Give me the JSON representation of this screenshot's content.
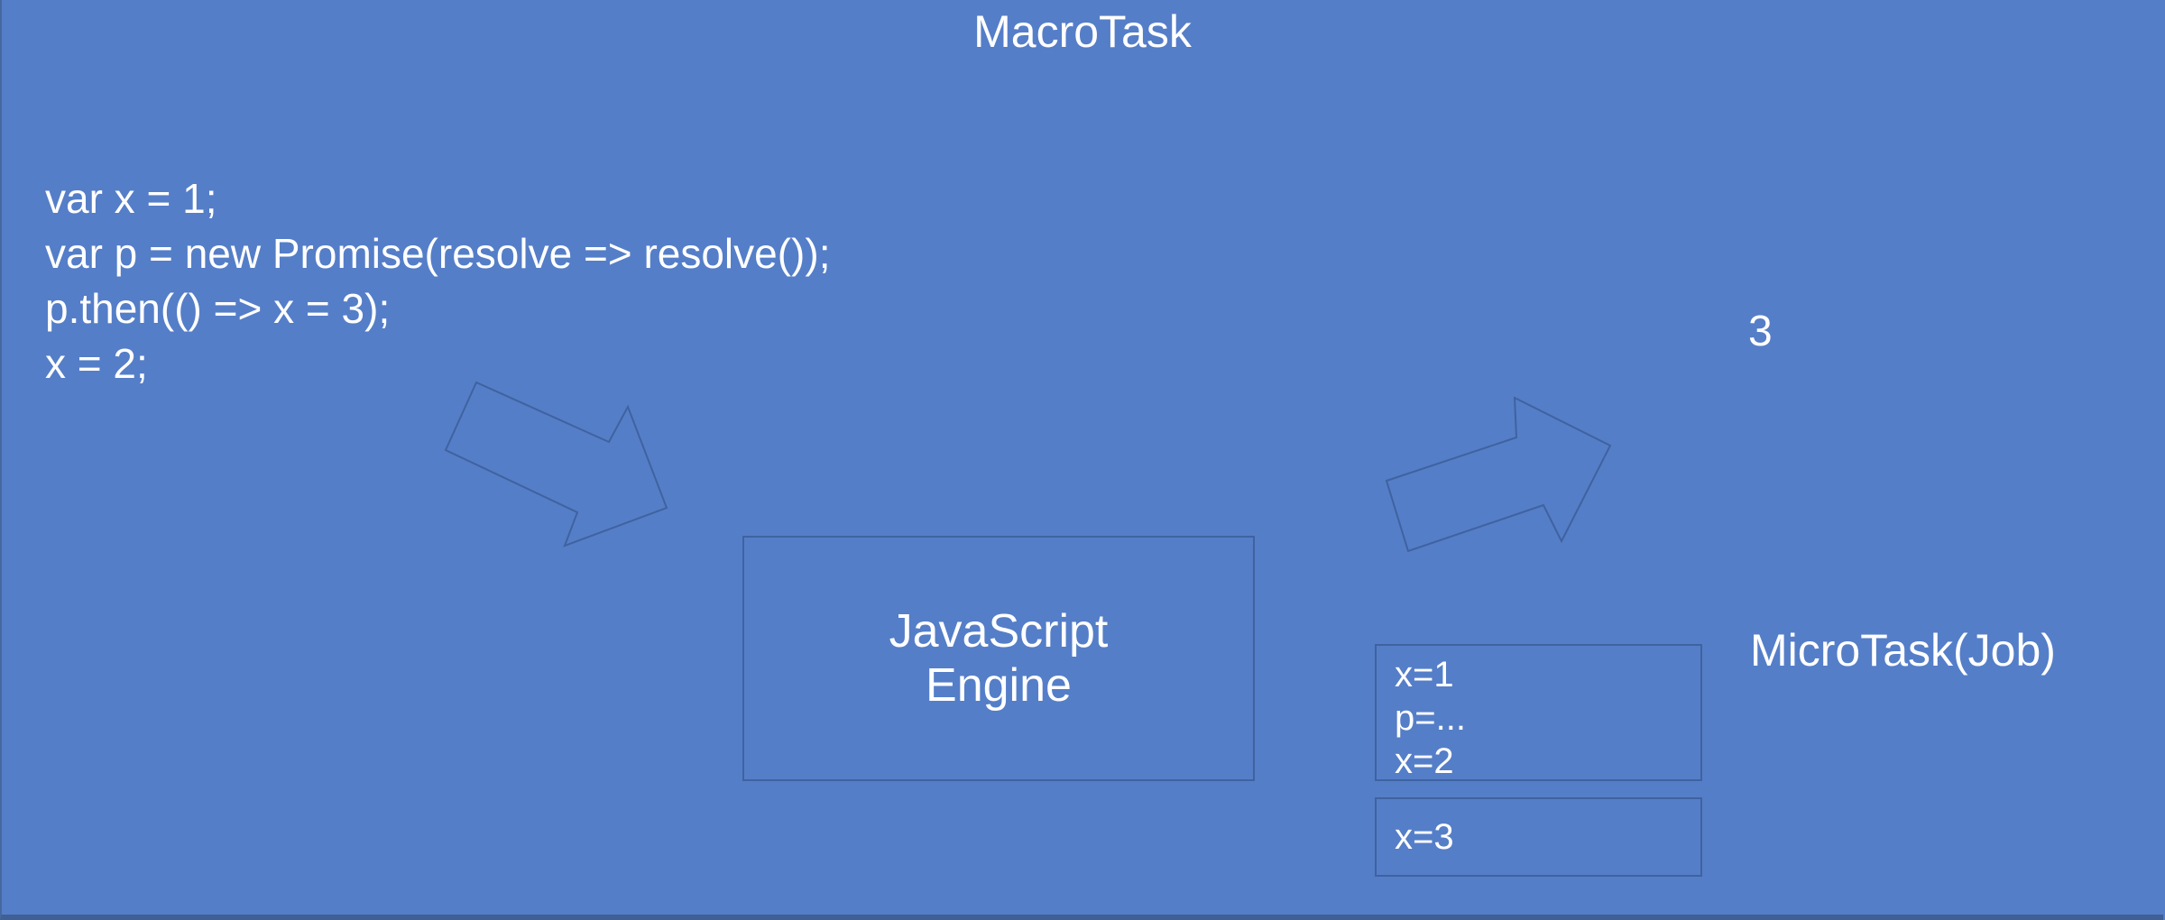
{
  "title": "MacroTask",
  "code_lines": [
    "var x = 1;",
    "var p = new Promise(resolve => resolve());",
    "p.then(() => x = 3);",
    "x = 2;"
  ],
  "engine": {
    "line1": "JavaScript",
    "line2": "Engine"
  },
  "result": "3",
  "microtask_label": "MicroTask(Job)",
  "queue_box_1": [
    "x=1",
    "p=...",
    "x=2"
  ],
  "queue_box_2": [
    "x=3"
  ],
  "colors": {
    "background": "#557ec8",
    "border": "#3e63a0",
    "text": "#ffffff"
  }
}
